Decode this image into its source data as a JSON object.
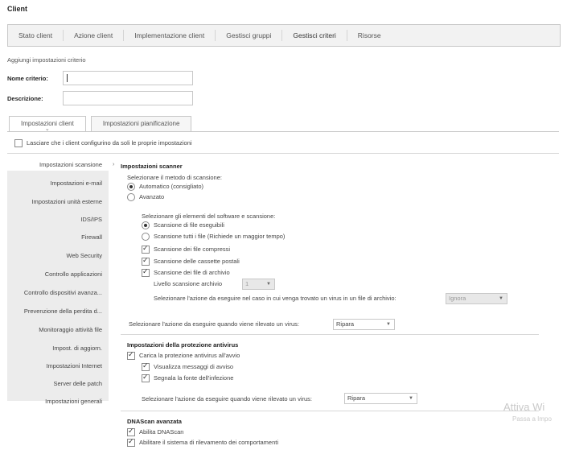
{
  "page": {
    "title": "Client"
  },
  "topnav": {
    "tabs": [
      {
        "label": "Stato client"
      },
      {
        "label": "Azione client"
      },
      {
        "label": "Implementazione client"
      },
      {
        "label": "Gestisci gruppi"
      },
      {
        "label": "Gestisci criteri"
      },
      {
        "label": "Risorse"
      }
    ]
  },
  "form": {
    "heading": "Aggiungi impostazioni criterio",
    "name_label": "Nome criterio:",
    "name_value": "",
    "desc_label": "Descrizione:",
    "desc_value": ""
  },
  "subtabs": {
    "client": "Impostazioni client",
    "schedule": "Impostazioni pianificazione"
  },
  "allow_clients": "Lasciare che i client configurino da soli le proprie impostazioni",
  "sidebar": {
    "items": [
      "Impostazioni scansione",
      "Impostazioni e-mail",
      "Impostazioni unità esterne",
      "IDS/IPS",
      "Firewall",
      "Web Security",
      "Controllo applicazioni",
      "Controllo dispositivi avanza...",
      "Prevenzione della perdita d...",
      "Monitoraggio attività file",
      "Impost. di aggiorn.",
      "Impostazioni Internet",
      "Server delle patch",
      "Impostazioni generali"
    ],
    "arrow": "›"
  },
  "scanner": {
    "heading": "Impostazioni scanner",
    "method_label": "Selezionare il metodo di scansione:",
    "auto_label": "Automatico (consigliato)",
    "advanced_label": "Avanzato",
    "select_items_label": "Selezionare gli elementi del software e scansione:",
    "scan_exec_label": "Scansione di file eseguibili",
    "scan_all_label": "Scansione tutti i file (Richiede un maggior tempo)",
    "compressed_label": "Scansione dei file compressi",
    "mailbox_label": "Scansione delle cassette postali",
    "archive_label": "Scansione dei file di archivio",
    "archive_level_label": "Livello scansione archivio",
    "archive_level_value": "1",
    "archive_action_label": "Selezionare l'azione da eseguire nel caso in cui venga trovato un virus in un file di archivio:",
    "archive_action_value": "Ignora",
    "virus_action_label": "Selezionare l'azione da eseguire quando viene rilevato un virus:",
    "virus_action_value": "Ripara"
  },
  "protection": {
    "heading": "Impostazioni della protezione antivirus",
    "load_label": "Carica la protezione antivirus all'avvio",
    "show_warn_label": "Visualizza messaggi di avviso",
    "report_label": "Segnala la fonte dell'infezione",
    "virus_action_label": "Selezionare l'azione da eseguire quando viene rilevato un virus:",
    "virus_action_value": "Ripara"
  },
  "dnascan": {
    "heading": "DNAScan avanzata",
    "enable_label": "Abilita DNAScan",
    "behavior_label": "Abilitare il sistema di rilevamento dei comportamenti"
  },
  "watermark": {
    "line1": "Attiva Wi",
    "line2": "Passa a Impo"
  }
}
